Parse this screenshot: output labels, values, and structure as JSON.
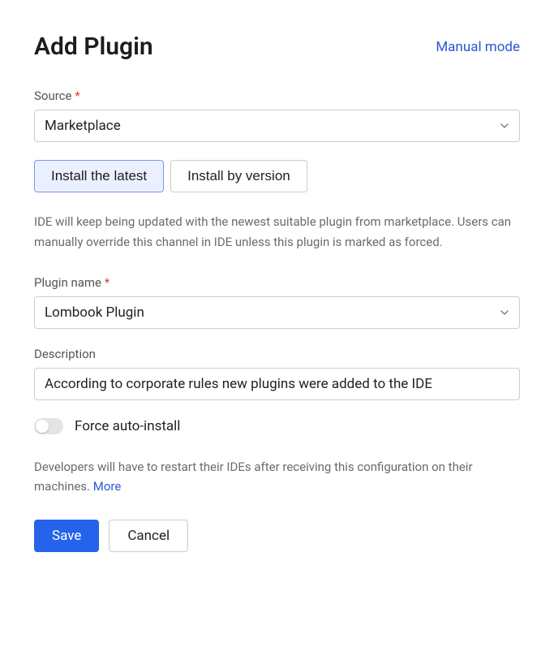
{
  "header": {
    "title": "Add Plugin",
    "manual_mode": "Manual mode"
  },
  "source": {
    "label": "Source",
    "value": "Marketplace"
  },
  "install_mode": {
    "latest": "Install the latest",
    "by_version": "Install by version",
    "help": "IDE will keep being updated with the newest suitable plugin from marketplace. Users can manually override this channel in IDE unless this plugin is marked as forced."
  },
  "plugin_name": {
    "label": "Plugin name",
    "value": "Lombook Plugin"
  },
  "description": {
    "label": "Description",
    "value": "According to corporate rules new plugins were added to the IDE"
  },
  "force": {
    "label": "Force auto-install"
  },
  "restart_help": {
    "text": "Developers will have to restart their IDEs after receiving this configuration on their machines. ",
    "more": "More"
  },
  "actions": {
    "save": "Save",
    "cancel": "Cancel"
  }
}
